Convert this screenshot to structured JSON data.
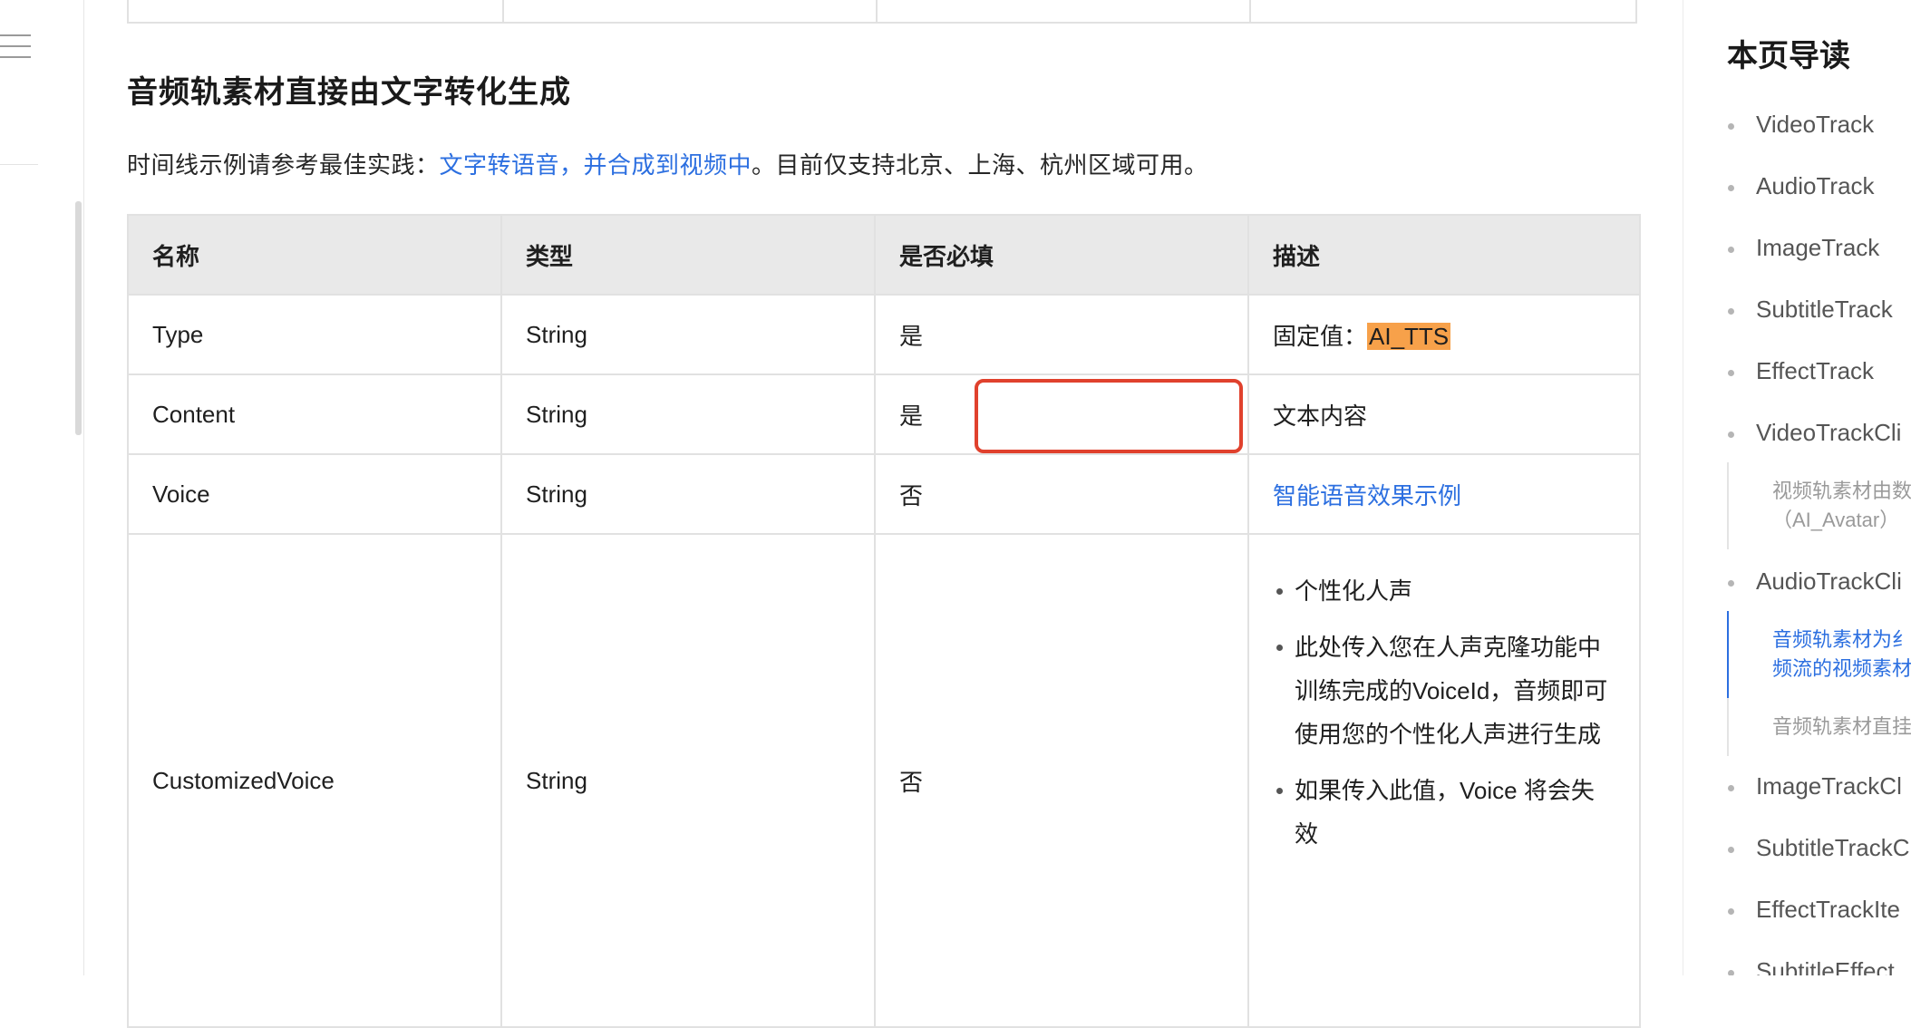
{
  "section": {
    "title": "音频轨素材直接由文字转化生成",
    "intro_prefix": "时间线示例请参考最佳实践：",
    "intro_link": "文字转语音，并合成到视频中",
    "intro_suffix": "。目前仅支持北京、上海、杭州区域可用。"
  },
  "table": {
    "headers": [
      "名称",
      "类型",
      "是否必填",
      "描述"
    ],
    "rows": [
      {
        "name": "Type",
        "type": "String",
        "required": "是",
        "desc_prefix": "固定值：",
        "desc_highlight": "AI_TTS"
      },
      {
        "name": "Content",
        "type": "String",
        "required": "是",
        "desc": "文本内容"
      },
      {
        "name": "Voice",
        "type": "String",
        "required": "否",
        "desc_link": "智能语音效果示例"
      },
      {
        "name": "CustomizedVoice",
        "type": "String",
        "required": "否",
        "bullets": [
          "个性化人声",
          "此处传入您在人声克隆功能中训练完成的VoiceId，音频即可使用您的个性化人声进行生成",
          "如果传入此值，Voice 将会失效"
        ]
      }
    ]
  },
  "toc": {
    "title": "本页导读",
    "items": [
      "VideoTrack",
      "AudioTrack",
      "ImageTrack",
      "SubtitleTrack",
      "EffectTrack",
      "VideoTrackCli",
      "AudioTrackCli",
      "ImageTrackCl",
      "SubtitleTrackC",
      "EffectTrackIte",
      "SubtitleEffect"
    ],
    "sub_video": "视频轨素材由数\n（AI_Avatar）",
    "sub_audio_active": "音频轨素材为纟\n频流的视频素材",
    "sub_audio": "音频轨素材直挂"
  },
  "colors": {
    "link": "#2c6fe0",
    "highlight": "#f7a14a",
    "annotation": "#e0412d"
  }
}
